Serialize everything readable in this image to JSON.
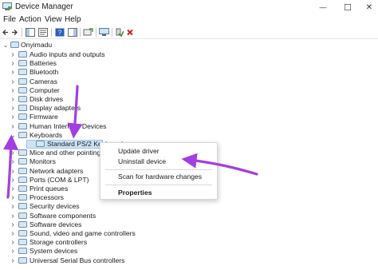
{
  "window": {
    "title": "Device Manager",
    "minimize_glyph": "—",
    "maximize_glyph": "☐",
    "close_glyph": "✕"
  },
  "menu": [
    "File",
    "Action",
    "View",
    "Help"
  ],
  "tree": {
    "root": "Onyimadu",
    "categories": [
      {
        "label": "Audio inputs and outputs",
        "icon": "speaker-icon"
      },
      {
        "label": "Batteries",
        "icon": "battery-icon"
      },
      {
        "label": "Bluetooth",
        "icon": "bluetooth-icon"
      },
      {
        "label": "Cameras",
        "icon": "camera-icon"
      },
      {
        "label": "Computer",
        "icon": "computer-icon"
      },
      {
        "label": "Disk drives",
        "icon": "disk-icon"
      },
      {
        "label": "Display adapters",
        "icon": "display-icon"
      },
      {
        "label": "Firmware",
        "icon": "chip-icon"
      },
      {
        "label": "Human Interface Devices",
        "icon": "hid-icon"
      },
      {
        "label": "Keyboards",
        "icon": "keyboard-icon",
        "expanded": true
      },
      {
        "label": "Standard PS/2 Keyboard",
        "icon": "keyboard-icon",
        "child": true,
        "selected": true
      },
      {
        "label": "Mice and other pointing devices",
        "icon": "mouse-icon"
      },
      {
        "label": "Monitors",
        "icon": "monitor-icon"
      },
      {
        "label": "Network adapters",
        "icon": "network-icon"
      },
      {
        "label": "Ports (COM & LPT)",
        "icon": "port-icon"
      },
      {
        "label": "Print queues",
        "icon": "printer-icon"
      },
      {
        "label": "Processors",
        "icon": "cpu-icon"
      },
      {
        "label": "Security devices",
        "icon": "security-icon"
      },
      {
        "label": "Software components",
        "icon": "component-icon"
      },
      {
        "label": "Software devices",
        "icon": "software-icon"
      },
      {
        "label": "Sound, video and game controllers",
        "icon": "sound-icon"
      },
      {
        "label": "Storage controllers",
        "icon": "storage-icon"
      },
      {
        "label": "System devices",
        "icon": "system-icon"
      },
      {
        "label": "Universal Serial Bus controllers",
        "icon": "usb-icon"
      }
    ]
  },
  "context_menu": {
    "update_driver": "Update driver",
    "uninstall_device": "Uninstall device",
    "scan_changes": "Scan for hardware changes",
    "properties": "Properties"
  },
  "colors": {
    "accent": "#0067c0",
    "annotation_arrow": "#a23fe0",
    "selection": "#cfe3f5"
  }
}
